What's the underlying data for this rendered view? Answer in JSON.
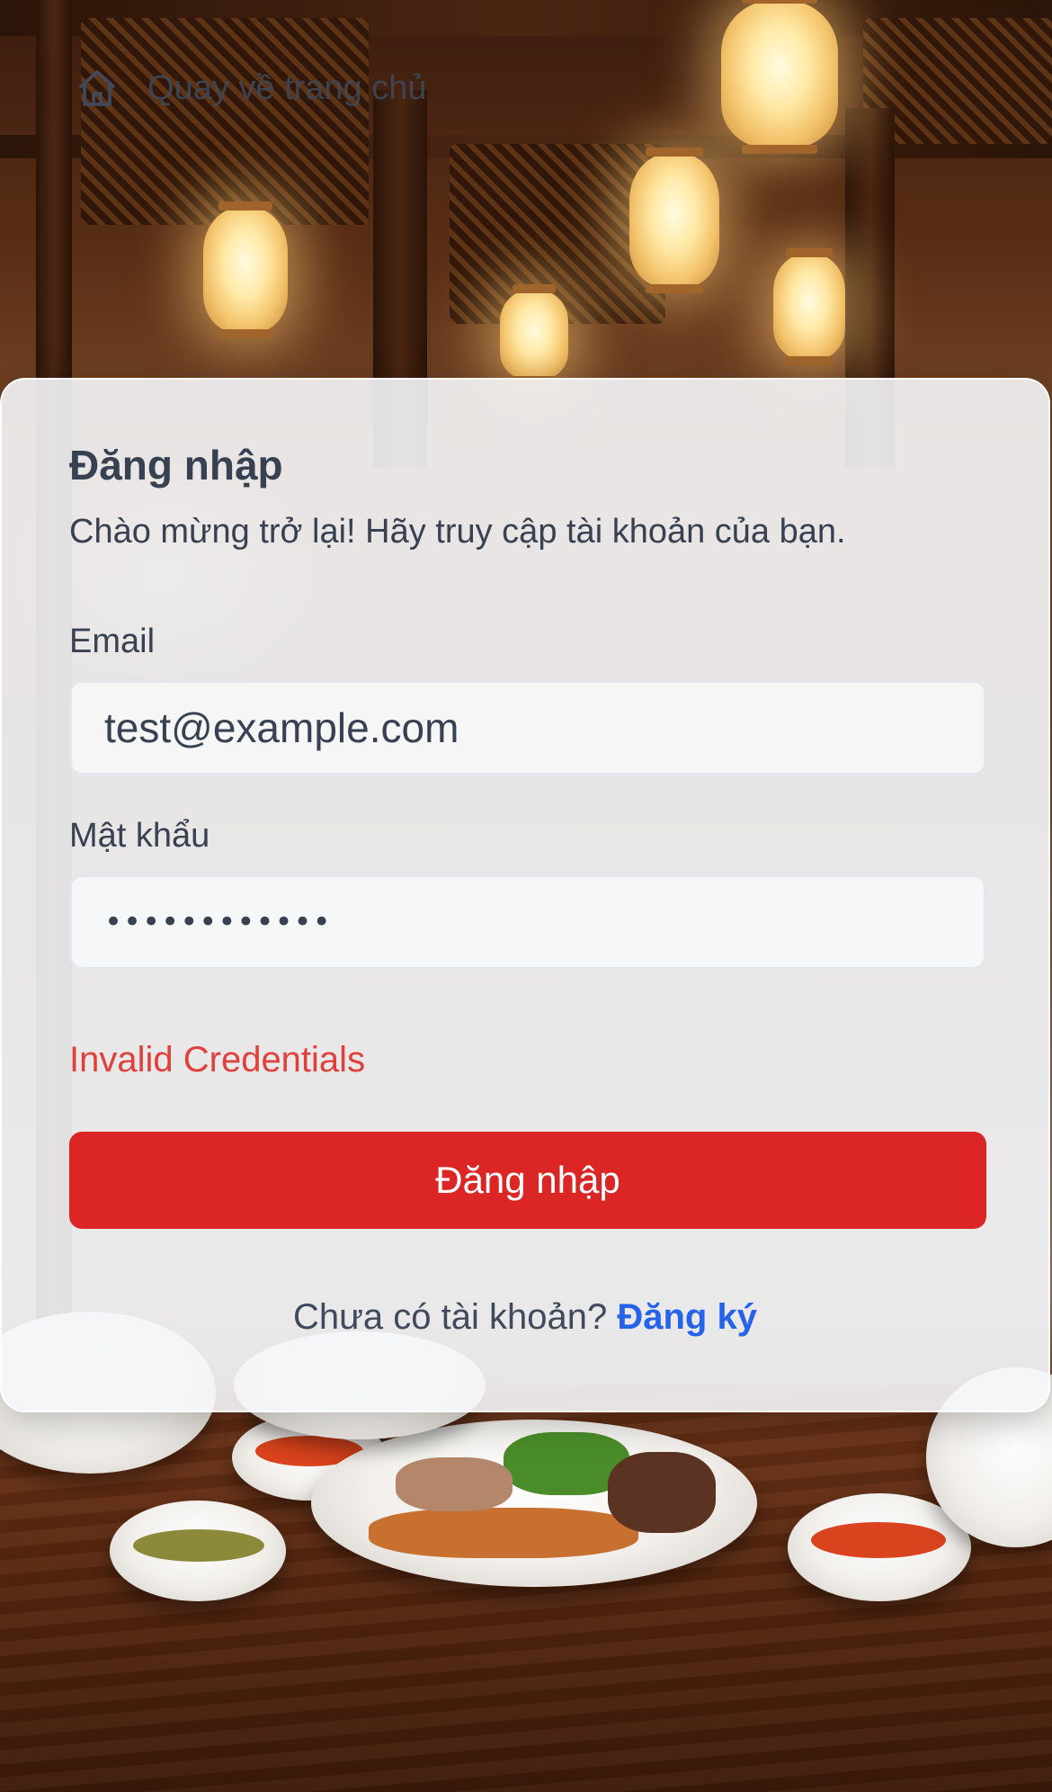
{
  "nav": {
    "home_icon": "home-icon",
    "back_home_label": "Quay về trang chủ"
  },
  "login": {
    "title": "Đăng nhập",
    "subtitle": "Chào mừng trở lại! Hãy truy cập tài khoản của bạn.",
    "email": {
      "label": "Email",
      "value": "test@example.com"
    },
    "password": {
      "label": "Mật khẩu",
      "value": "••••••••••••"
    },
    "error_message": "Invalid Credentials",
    "submit_label": "Đăng nhập",
    "signup_prompt": "Chưa có tài khoản?",
    "signup_link_label": "Đăng ký"
  },
  "colors": {
    "primary_button": "#dc2626",
    "error": "#e0403b",
    "link": "#2563eb",
    "text": "#374151"
  }
}
